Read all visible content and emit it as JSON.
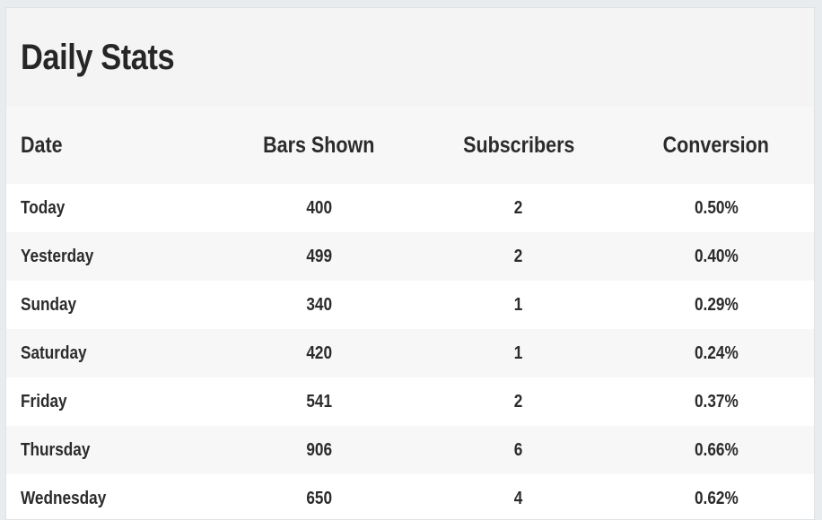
{
  "panel": {
    "title": "Daily Stats"
  },
  "table": {
    "headers": [
      "Date",
      "Bars Shown",
      "Subscribers",
      "Conversion"
    ],
    "rows": [
      [
        "Today",
        "400",
        "2",
        "0.50%"
      ],
      [
        "Yesterday",
        "499",
        "2",
        "0.40%"
      ],
      [
        "Sunday",
        "340",
        "1",
        "0.29%"
      ],
      [
        "Saturday",
        "420",
        "1",
        "0.24%"
      ],
      [
        "Friday",
        "541",
        "2",
        "0.37%"
      ],
      [
        "Thursday",
        "906",
        "6",
        "0.66%"
      ],
      [
        "Wednesday",
        "650",
        "4",
        "0.62%"
      ]
    ]
  }
}
